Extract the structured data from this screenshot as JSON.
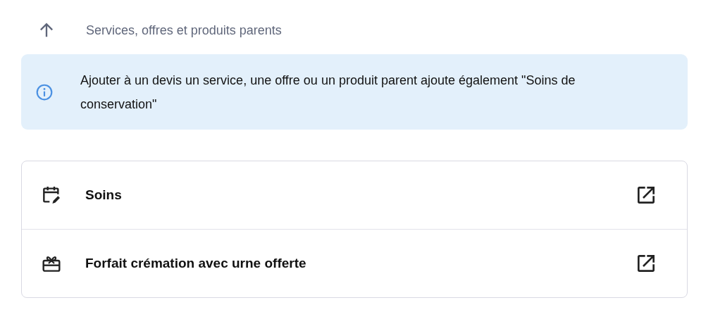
{
  "header": {
    "title": "Services, offres et produits parents"
  },
  "info": {
    "text": "Ajouter à un devis un service, une offre ou un produit parent ajoute également \"Soins de conservation\""
  },
  "items": [
    {
      "kind": "service",
      "label": "Soins"
    },
    {
      "kind": "offer",
      "label": "Forfait crémation avec urne offerte"
    }
  ]
}
